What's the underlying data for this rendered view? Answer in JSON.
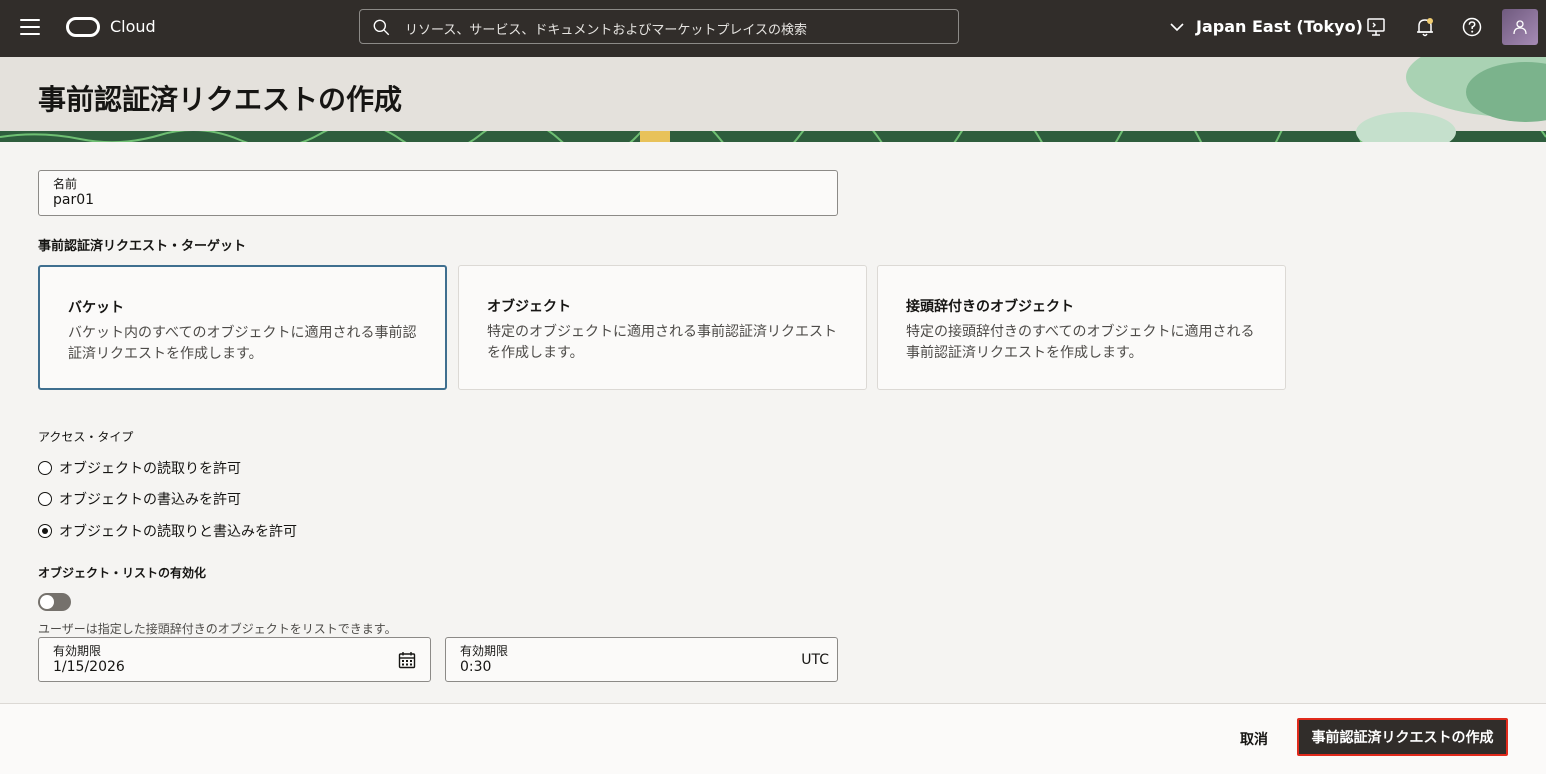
{
  "topbar": {
    "brand": "Cloud",
    "search_placeholder": "リソース、サービス、ドキュメントおよびマーケットプレイスの検索",
    "region": "Japan East (Tokyo)"
  },
  "page": {
    "title": "事前認証済リクエストの作成"
  },
  "form": {
    "name_label": "名前",
    "name_value": "par01",
    "target_heading": "事前認証済リクエスト・ターゲット",
    "targets": [
      {
        "title": "バケット",
        "description": "バケット内のすべてのオブジェクトに適用される事前認証済リクエストを作成します。",
        "selected": true
      },
      {
        "title": "オブジェクト",
        "description": "特定のオブジェクトに適用される事前認証済リクエストを作成します。",
        "selected": false
      },
      {
        "title": "接頭辞付きのオブジェクト",
        "description": "特定の接頭辞付きのすべてのオブジェクトに適用される事前認証済リクエストを作成します。",
        "selected": false
      }
    ],
    "access_type_label": "アクセス・タイプ",
    "access_options": [
      {
        "label": "オブジェクトの読取りを許可",
        "checked": false
      },
      {
        "label": "オブジェクトの書込みを許可",
        "checked": false
      },
      {
        "label": "オブジェクトの読取りと書込みを許可",
        "checked": true
      }
    ],
    "object_listing_label": "オブジェクト・リストの有効化",
    "object_listing_enabled": false,
    "object_listing_hint": "ユーザーは指定した接頭辞付きのオブジェクトをリストできます。",
    "expiry_date_label": "有効期限",
    "expiry_date_value": "1/15/2026",
    "expiry_time_label": "有効期限",
    "expiry_time_value": "0:30",
    "timezone": "UTC"
  },
  "footer": {
    "cancel_label": "取消",
    "submit_label": "事前認証済リクエストの作成"
  },
  "colors": {
    "topbar_bg": "#312d2a",
    "selected_border": "#3f6f8f",
    "focus_ring": "#e02a1c"
  }
}
